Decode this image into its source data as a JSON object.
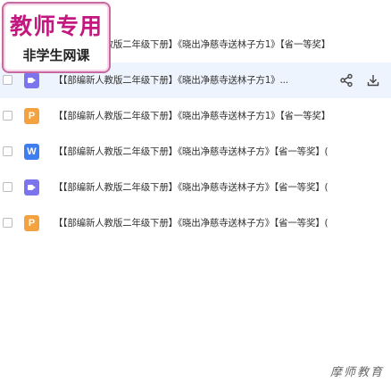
{
  "watermark": {
    "line1": "教师专用",
    "line2": "非学生网课"
  },
  "files": [
    {
      "icon": "video-file-icon",
      "type": "video",
      "glyph": "",
      "name": "【【部编新人教版二年级下册】《晓出净慈寺送林子方1》【省一等奖】",
      "selected": false
    },
    {
      "icon": "video-file-icon",
      "type": "video",
      "glyph": "",
      "name": "【【部编新人教版二年级下册】《晓出净慈寺送林子方1》...",
      "selected": true
    },
    {
      "icon": "ppt-file-icon",
      "type": "ppt",
      "glyph": "P",
      "name": "【【部编新人教版二年级下册】《晓出净慈寺送林子方1》【省一等奖】",
      "selected": false
    },
    {
      "icon": "word-file-icon",
      "type": "word",
      "glyph": "W",
      "name": "【【部编新人教版二年级下册】《晓出净慈寺送林子方》【省一等奖】(",
      "selected": false
    },
    {
      "icon": "video-file-icon",
      "type": "video",
      "glyph": "",
      "name": "【【部编新人教版二年级下册】《晓出净慈寺送林子方》【省一等奖】(",
      "selected": false
    },
    {
      "icon": "ppt-file-icon",
      "type": "ppt",
      "glyph": "P",
      "name": "【【部编新人教版二年级下册】《晓出净慈寺送林子方》【省一等奖】(",
      "selected": false
    }
  ],
  "actions": {
    "share_icon": "share-icon",
    "download_icon": "download-icon"
  },
  "brand": "摩师教育",
  "colors": {
    "selected_row": "#eef4fd",
    "video": "#7b74ec",
    "ppt": "#f4a13f",
    "word": "#3f7ef0",
    "watermark_text": "#c2187f",
    "watermark_border": "#c86aa2"
  }
}
